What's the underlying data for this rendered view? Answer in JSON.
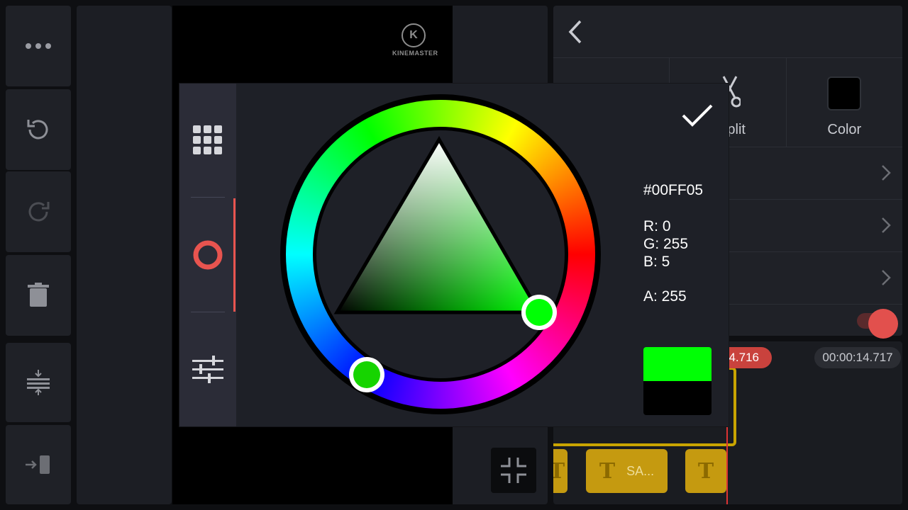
{
  "rail": {
    "more_icon": "more-horizontal-icon",
    "undo_icon": "undo-icon",
    "redo_icon": "redo-icon",
    "delete_icon": "trash-icon",
    "adjust_icon": "track-height-icon",
    "export_icon": "export-icon"
  },
  "preview": {
    "logo_letter": "K",
    "logo_text": "KINEMASTER"
  },
  "right_panel": {
    "tabs": [
      {
        "label": "",
        "icon": "text-icon"
      },
      {
        "label": "/ Split",
        "icon": "scissors-icon"
      },
      {
        "label": "Color",
        "icon": "color-swatch"
      }
    ]
  },
  "timeline": {
    "current_time": "14.716",
    "end_time": "00:00:14.717",
    "clips": [
      {
        "icon": "T",
        "label": ""
      },
      {
        "icon": "T",
        "label": "SA..."
      },
      {
        "icon": "T",
        "label": ""
      }
    ]
  },
  "color_picker": {
    "hex": "#00FF05",
    "r": "R: 0",
    "g": "G: 255",
    "b": "B: 5",
    "a": "A: 255",
    "new_color": "#00FF05",
    "old_color": "#000000",
    "modes": [
      "swatch-grid-icon",
      "color-wheel-icon",
      "sliders-icon"
    ],
    "active_mode": "color-wheel-icon"
  }
}
